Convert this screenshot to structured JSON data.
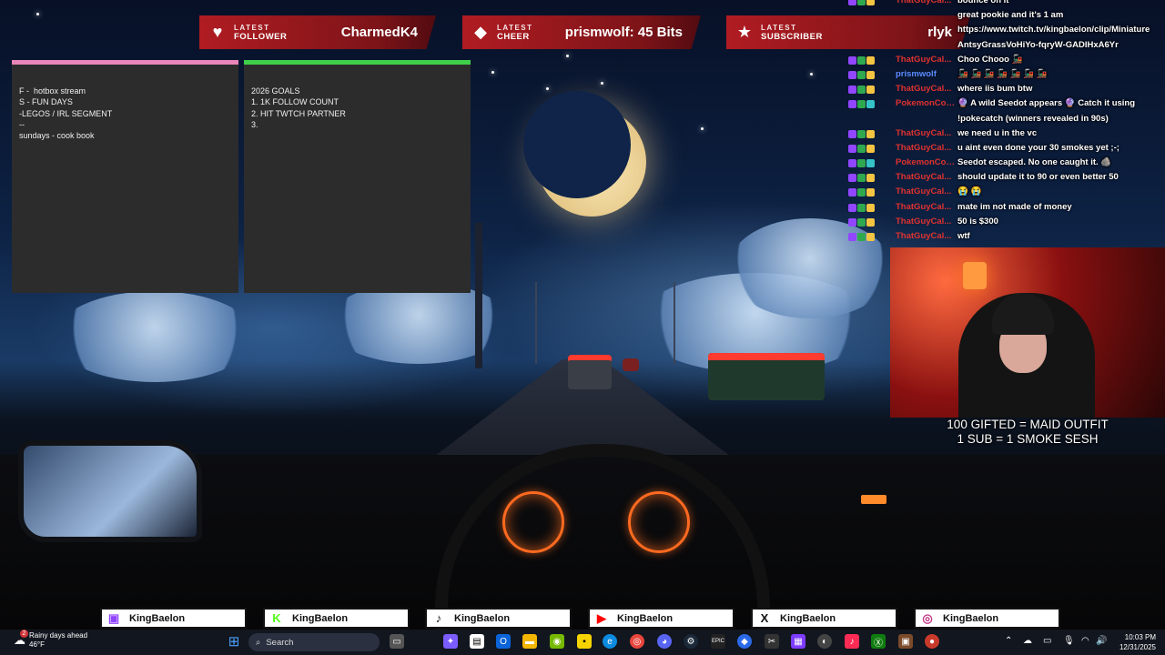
{
  "alerts": [
    {
      "line1": "LATEST",
      "line2": "FOLLOWER",
      "value": "CharmedK4",
      "icon": "heart-icon"
    },
    {
      "line1": "LATEST",
      "line2": "CHEER",
      "value": "prismwolf: 45 Bits",
      "icon": "diamond-icon"
    },
    {
      "line1": "LATEST",
      "line2": "SUBSCRIBER",
      "value": "rlyk",
      "icon": "star-icon"
    }
  ],
  "notes": [
    {
      "text": "F -  hotbox stream\nS - FUN DAYS\n-LEGOS / IRL SEGMENT\n--\nsundays - cook book",
      "color": "#e985b8"
    },
    {
      "text": "2026 GOALS\n1. 1K FOLLOW COUNT\n2. HIT TWTCH PARTNER\n3.",
      "color": "#3fcf4a"
    }
  ],
  "chat": [
    {
      "user": "ThatGuyCal...",
      "color": "#e0322f",
      "text": "bounce on it",
      "badges": [
        "#9146ff",
        "#2fa84f",
        "#f4c542"
      ]
    },
    {
      "user": "",
      "color": "#e0322f",
      "text": "great pookie and it's 1 am",
      "badges": []
    },
    {
      "user": "",
      "color": "#e0322f",
      "text": "https://www.twitch.tv/kingbaelon/clip/Miniature",
      "badges": []
    },
    {
      "user": "",
      "color": "#e0322f",
      "text": "AntsyGrassVoHiYo-fqryW-GADIHxA6Yr",
      "badges": []
    },
    {
      "user": "ThatGuyCal...",
      "color": "#e0322f",
      "text": "Choo Chooo 🚂",
      "badges": [
        "#9146ff",
        "#2fa84f",
        "#f4c542"
      ]
    },
    {
      "user": "prismwolf",
      "color": "#5a8bff",
      "text": "🚂 🚂 🚂 🚂 🚂 🚂 🚂",
      "badges": [
        "#9146ff",
        "#2fa84f",
        "#f4c542"
      ]
    },
    {
      "user": "ThatGuyCal...",
      "color": "#e0322f",
      "text": "where iis bum btw",
      "badges": [
        "#9146ff",
        "#2fa84f",
        "#f4c542"
      ]
    },
    {
      "user": "PokemonCom...",
      "color": "#e0322f",
      "text": "🔮 A wild Seedot appears 🔮 Catch it using",
      "badges": [
        "#9146ff",
        "#2fa84f",
        "#35c3c8"
      ]
    },
    {
      "user": "",
      "color": "#e0322f",
      "text": "!pokecatch (winners revealed in 90s)",
      "badges": []
    },
    {
      "user": "ThatGuyCal...",
      "color": "#e0322f",
      "text": "we need u in the vc",
      "badges": [
        "#9146ff",
        "#2fa84f",
        "#f4c542"
      ]
    },
    {
      "user": "ThatGuyCal...",
      "color": "#e0322f",
      "text": "u aint even done your 30 smokes yet ;-;",
      "badges": [
        "#9146ff",
        "#2fa84f",
        "#f4c542"
      ]
    },
    {
      "user": "PokemonCom...",
      "color": "#e0322f",
      "text": "Seedot escaped. No one caught it. 🪨",
      "badges": [
        "#9146ff",
        "#2fa84f",
        "#35c3c8"
      ]
    },
    {
      "user": "ThatGuyCal...",
      "color": "#e0322f",
      "text": "should update it to 90 or even better 50",
      "badges": [
        "#9146ff",
        "#2fa84f",
        "#f4c542"
      ]
    },
    {
      "user": "ThatGuyCal...",
      "color": "#e0322f",
      "text": "😭 😭",
      "badges": [
        "#9146ff",
        "#2fa84f",
        "#f4c542"
      ]
    },
    {
      "user": "ThatGuyCal...",
      "color": "#e0322f",
      "text": "mate im not made of money",
      "badges": [
        "#9146ff",
        "#2fa84f",
        "#f4c542"
      ]
    },
    {
      "user": "ThatGuyCal...",
      "color": "#e0322f",
      "text": "50 is $300",
      "badges": [
        "#9146ff",
        "#2fa84f",
        "#f4c542"
      ]
    },
    {
      "user": "ThatGuyCal...",
      "color": "#e0322f",
      "text": "wtf",
      "badges": [
        "#9146ff",
        "#2fa84f",
        "#f4c542"
      ]
    }
  ],
  "webcam": {
    "goal_line1": "100 GIFTED = MAID OUTFIT",
    "goal_line2": "1 SUB = 1 SMOKE SESH"
  },
  "socials": [
    {
      "platform": "twitch-icon",
      "glyph": "▣",
      "color": "#9146ff",
      "handle": "KingBaelon"
    },
    {
      "platform": "kick-icon",
      "glyph": "K",
      "color": "#53fc18",
      "handle": "KingBaelon"
    },
    {
      "platform": "tiktok-icon",
      "glyph": "♪",
      "color": "#111111",
      "handle": "KingBaelon"
    },
    {
      "platform": "youtube-icon",
      "glyph": "▶",
      "color": "#ff0000",
      "handle": "KingBaelon"
    },
    {
      "platform": "x-icon",
      "glyph": "X",
      "color": "#111111",
      "handle": "KingBaelon"
    },
    {
      "platform": "instagram-icon",
      "glyph": "◎",
      "color": "#c13584",
      "handle": "KingBaelon"
    }
  ],
  "taskbar": {
    "weather_line1": "Rainy days ahead",
    "weather_line2": "46°F",
    "weather_badge": "2",
    "search_placeholder": "Search",
    "time": "10:03 PM",
    "date": "12/31/2025"
  }
}
